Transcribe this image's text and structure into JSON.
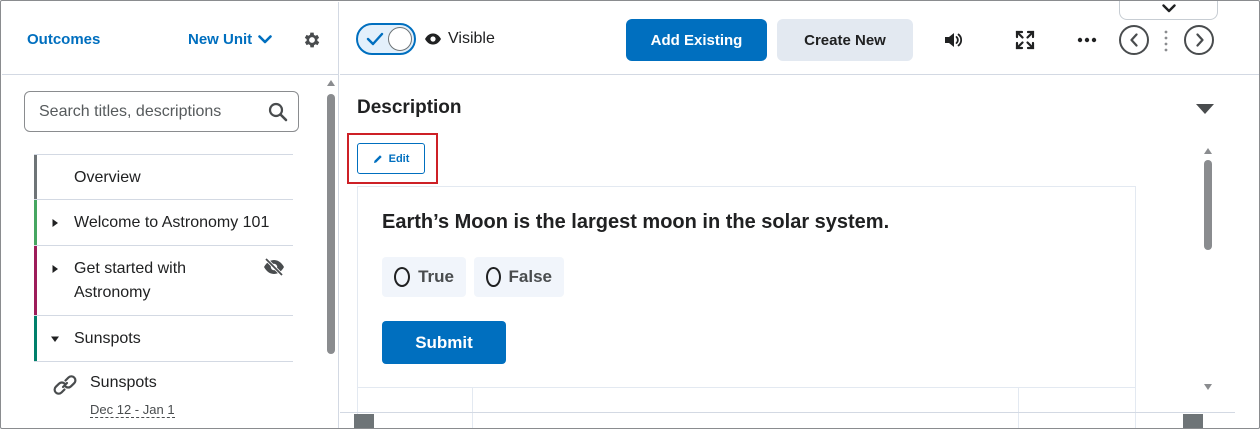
{
  "sidebar": {
    "outcomes_label": "Outcomes",
    "new_unit_label": "New Unit",
    "search_placeholder": "Search titles, descriptions",
    "items": [
      {
        "label": "Overview",
        "color": "#6e7477",
        "caret": "none"
      },
      {
        "label": "Welcome to Astronomy 101",
        "color": "#46a661",
        "caret": "right"
      },
      {
        "label_line1": "Get started with",
        "label_line2": "Astronomy",
        "color": "#9d1d5a",
        "caret": "right",
        "hidden_icon": "eye-slash-icon"
      },
      {
        "label": "Sunspots",
        "color": "#00806b",
        "caret": "down"
      }
    ],
    "sub_item": {
      "label": "Sunspots",
      "dates": "Dec 12 - Jan 1",
      "icon": "link-icon"
    }
  },
  "toolbar": {
    "visibility_label": "Visible",
    "add_existing_label": "Add Existing",
    "create_new_label": "Create New"
  },
  "content": {
    "section_title": "Description",
    "edit_label": "Edit",
    "question": "Earth’s Moon is the largest moon in the solar system.",
    "choices": [
      "True",
      "False"
    ],
    "submit_label": "Submit"
  },
  "colors": {
    "primary": "#006fbf",
    "highlight_outline": "#cd2026"
  }
}
